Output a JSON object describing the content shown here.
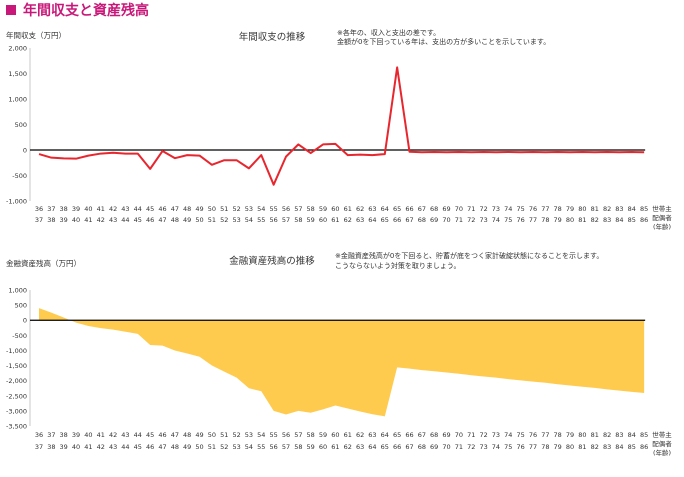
{
  "page": {
    "title": "年間収支と資産残高",
    "colors": {
      "accent": "#c8197a",
      "line": "#e8262e",
      "area": "#ffcb4f"
    }
  },
  "chart_data": [
    {
      "type": "line",
      "title": "年間収支の推移",
      "ylabel": "年間収支（万円）",
      "xlabel": "",
      "ylim": [
        -1000,
        2000
      ],
      "yticks": [
        2000,
        1500,
        1000,
        500,
        0,
        -500,
        -1000
      ],
      "ytick_labels": [
        "2,000",
        "1,500",
        "1,000",
        "500",
        "0",
        "-500",
        "-1,000"
      ],
      "grid": false,
      "zero_line": true,
      "note": [
        "※各年の、収入と支出の差です。",
        "金額が0を下回っている年は、支出の方が多いことを示しています。"
      ],
      "x_row1": [
        36,
        37,
        38,
        39,
        40,
        41,
        42,
        43,
        44,
        45,
        46,
        47,
        48,
        49,
        50,
        51,
        52,
        53,
        54,
        55,
        56,
        57,
        58,
        59,
        60,
        61,
        62,
        63,
        64,
        65,
        66,
        67,
        68,
        69,
        70,
        71,
        72,
        73,
        74,
        75,
        76,
        77,
        78,
        79,
        80,
        81,
        82,
        83,
        84,
        85
      ],
      "x_row2": [
        37,
        38,
        39,
        40,
        41,
        42,
        43,
        44,
        45,
        46,
        47,
        48,
        49,
        50,
        51,
        52,
        53,
        54,
        55,
        56,
        57,
        58,
        59,
        60,
        61,
        62,
        63,
        64,
        65,
        66,
        67,
        68,
        69,
        70,
        71,
        72,
        73,
        74,
        75,
        76,
        77,
        78,
        79,
        80,
        81,
        82,
        83,
        84,
        85,
        86
      ],
      "x_axis_unit": [
        "世帯主",
        "配偶者",
        "(年齢)"
      ],
      "series": [
        {
          "values": [
            -80,
            -150,
            -165,
            -170,
            -110,
            -70,
            -55,
            -70,
            -70,
            -370,
            -20,
            -160,
            -100,
            -110,
            -290,
            -200,
            -200,
            -360,
            -100,
            -680,
            -130,
            110,
            -60,
            110,
            120,
            -100,
            -90,
            -100,
            -80,
            1620,
            -35,
            -45,
            -40,
            -45,
            -40,
            -45,
            -40,
            -45,
            -40,
            -45,
            -40,
            -45,
            -40,
            -45,
            -40,
            -45,
            -40,
            -45,
            -40,
            -45
          ]
        }
      ]
    },
    {
      "type": "area",
      "title": "金融資産残高の推移",
      "ylabel": "金融資産残高（万円）",
      "xlabel": "",
      "ylim": [
        -3500,
        1000
      ],
      "yticks": [
        1000,
        500,
        0,
        -500,
        -1000,
        -1500,
        -2000,
        -2500,
        -3000,
        -3500
      ],
      "ytick_labels": [
        "1,000",
        "500",
        "0",
        "-500",
        "-1,000",
        "-1,500",
        "-2,000",
        "-2,500",
        "-3,000",
        "-3,500"
      ],
      "grid": false,
      "zero_line": true,
      "note": [
        "※金融資産残高が0を下回ると、貯蓄が底をつく家計破綻状態になることを示します。",
        "こうならないよう対策を取りましょう。"
      ],
      "x_row1": [
        36,
        37,
        38,
        39,
        40,
        41,
        42,
        43,
        44,
        45,
        46,
        47,
        48,
        49,
        50,
        51,
        52,
        53,
        54,
        55,
        56,
        57,
        58,
        59,
        60,
        61,
        62,
        63,
        64,
        65,
        66,
        67,
        68,
        69,
        70,
        71,
        72,
        73,
        74,
        75,
        76,
        77,
        78,
        79,
        80,
        81,
        82,
        83,
        84,
        85
      ],
      "x_row2": [
        37,
        38,
        39,
        40,
        41,
        42,
        43,
        44,
        45,
        46,
        47,
        48,
        49,
        50,
        51,
        52,
        53,
        54,
        55,
        56,
        57,
        58,
        59,
        60,
        61,
        62,
        63,
        64,
        65,
        66,
        67,
        68,
        69,
        70,
        71,
        72,
        73,
        74,
        75,
        76,
        77,
        78,
        79,
        80,
        81,
        82,
        83,
        84,
        85,
        86
      ],
      "x_axis_unit": [
        "世帯主",
        "配偶者",
        "(年齢)"
      ],
      "series": [
        {
          "values": [
            400,
            250,
            90,
            -80,
            -190,
            -260,
            -310,
            -380,
            -450,
            -820,
            -840,
            -1000,
            -1100,
            -1210,
            -1500,
            -1700,
            -1900,
            -2250,
            -2350,
            -3000,
            -3120,
            -3000,
            -3060,
            -2950,
            -2820,
            -2920,
            -3020,
            -3110,
            -3180,
            -1560,
            -1600,
            -1650,
            -1690,
            -1730,
            -1770,
            -1820,
            -1860,
            -1900,
            -1950,
            -1990,
            -2030,
            -2070,
            -2120,
            -2160,
            -2200,
            -2240,
            -2290,
            -2330,
            -2370,
            -2410
          ]
        }
      ]
    }
  ]
}
